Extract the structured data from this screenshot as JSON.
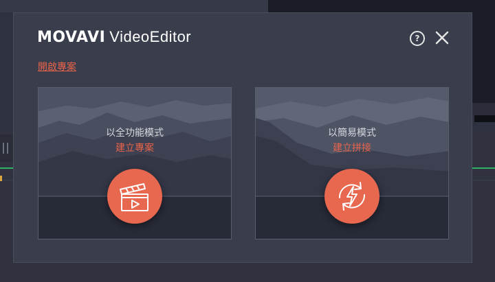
{
  "app": {
    "brand": "MOVAVI",
    "product": "VideoEditor",
    "open_project_link": "開啟專案"
  },
  "cards": [
    {
      "title": "以全功能模式",
      "action": "建立專案",
      "icon": "clapperboard-play-icon"
    },
    {
      "title": "以簡易模式",
      "action": "建立拼接",
      "icon": "refresh-lightning-icon"
    }
  ],
  "controls": {
    "help_icon": "help-icon",
    "help_glyph": "?",
    "close_icon": "close-icon"
  },
  "colors": {
    "accent": "#e8634a",
    "dialog_bg": "#3a3e4c",
    "text": "#d6d8de"
  }
}
